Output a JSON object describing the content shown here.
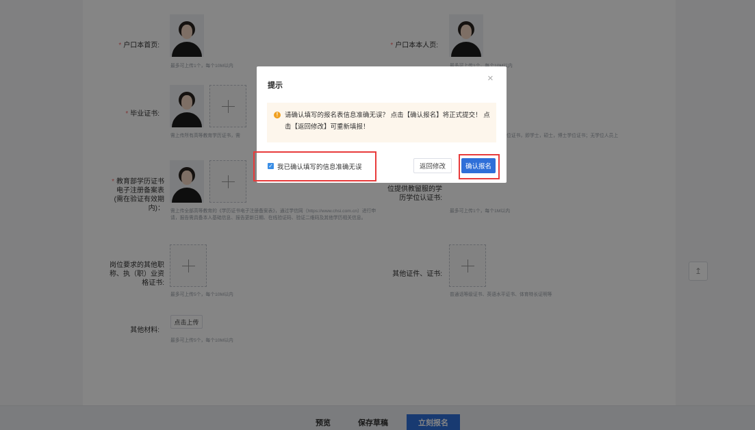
{
  "form": {
    "hukou_home_label": "户口本首页:",
    "hukou_home_tip": "最多可上传1个，每个10M以内",
    "hukou_self_label": "户口本本人页:",
    "hukou_self_tip": "最多可上传1个，每个10M以内",
    "grad_cert_label": "毕业证书:",
    "grad_cert_tip": "需上传所有高等教育学历证书，需",
    "grad_cert_tip_right": "位证书，即学士，硕士，博士学位证书；无学位人员上",
    "edu_record_label_l1": "教育部学历证书",
    "edu_record_label_l2": "电子注册备案表",
    "edu_record_label_l3": "(需在验证有效期",
    "edu_record_label_l4": "内)：",
    "edu_record_tip": "需上传全部高等教育的《学历证书电子注册备案表》，通过学信网（https://www.chsi.com.cn）进行申请，报告需具备本人基础信息、报告更新日期、在线验证码、验证二维码及其他学历相关信息。",
    "degree_label_l1": "位提供教留服的学",
    "degree_label_l2": "历学位认证书:",
    "degree_tip": "最多可上传1个，每个1M以内",
    "other_title_label_l1": "岗位要求的其他职",
    "other_title_label_l2": "称、执（职）业资",
    "other_title_label_l3": "格证书:",
    "other_title_tip": "最多可上传5个，每个10M以内",
    "other_cert_label": "其他证件、证书:",
    "other_cert_tip": "普通话等级证书、英语水平证书、体育特长证明等",
    "other_material_label": "其他材料:",
    "upload_button": "点击上传",
    "other_material_tip": "最多可上传5个，每个10M以内",
    "required_mark": "*"
  },
  "footer": {
    "preview": "预览",
    "save_draft": "保存草稿",
    "submit": "立刻报名"
  },
  "dialog": {
    "title": "提示",
    "close": "×",
    "alert_icon": "!",
    "alert_text": "请确认填写的报名表信息准确无误？ 点击【确认报名】将正式提交！ 点击【返回修改】可重新填报！",
    "checkbox_label": "我已确认填写的信息准确无误",
    "checkbox_checked": true,
    "back_button": "返回修改",
    "confirm_button": "确认报名"
  },
  "scroll_top_icon": "↥",
  "colors": {
    "primary": "#2f6fd8",
    "required": "#f56c6c",
    "highlight": "#e83a3a",
    "alert_bg": "#fdf6ec",
    "alert_icon": "#f0a020"
  }
}
